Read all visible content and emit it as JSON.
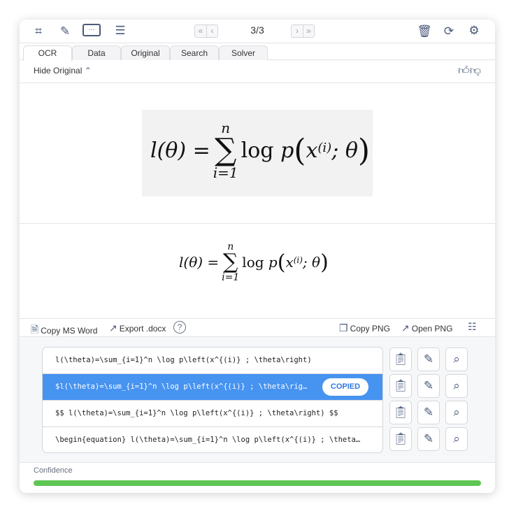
{
  "toolbar": {
    "icons": [
      "crop-icon",
      "pen-icon",
      "keyboard-icon",
      "list-icon",
      "trash-icon",
      "refresh-icon",
      "gear-icon"
    ],
    "first": "«",
    "prev": "‹",
    "next": "›",
    "last": "»",
    "page": "3/3"
  },
  "tabs": [
    {
      "label": "OCR",
      "active": true
    },
    {
      "label": "Data"
    },
    {
      "label": "Original"
    },
    {
      "label": "Search"
    },
    {
      "label": "Solver"
    }
  ],
  "hide_original": "Hide Original",
  "math": {
    "lhs": "l(θ) =",
    "sum": "∑",
    "upper": "n",
    "lower": "i=1",
    "log": "log",
    "p": "p",
    "open": "(",
    "x": "x",
    "sup": "(i)",
    "semi": "; θ",
    "close": ")"
  },
  "actions": {
    "copy_word": "Copy MS Word",
    "export_docx": "Export .docx",
    "help": "?",
    "copy_png": "Copy PNG",
    "open_png": "Open PNG"
  },
  "results": [
    {
      "text": "l(\\theta)=\\sum_{i=1}^n \\log p\\left(x^{(i)} ; \\theta\\right)"
    },
    {
      "text": "$l(\\theta)=\\sum_{i=1}^n \\log p\\left(x^{(i)} ; \\theta\\rig…",
      "selected": true,
      "badge": "COPIED"
    },
    {
      "text": "$$ l(\\theta)=\\sum_{i=1}^n \\log p\\left(x^{(i)} ; \\theta\\right) $$"
    },
    {
      "text": "\\begin{equation} l(\\theta)=\\sum_{i=1}^n \\log p\\left(x^{(i)} ; \\theta…"
    }
  ],
  "confidence": {
    "label": "Confidence",
    "value": 1.0,
    "color": "#5fc553"
  },
  "colors": {
    "accent": "#4793f0"
  }
}
